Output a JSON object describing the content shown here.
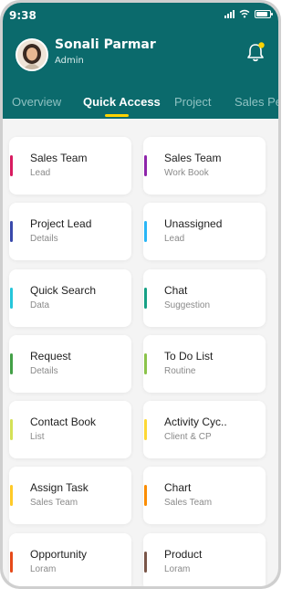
{
  "status_bar": {
    "time": "9:38"
  },
  "profile": {
    "name": "Sonali Parmar",
    "role": "Admin"
  },
  "tabs": [
    {
      "label": "Overview"
    },
    {
      "label": "Quick Access"
    },
    {
      "label": "Project"
    },
    {
      "label": "Sales Pe"
    }
  ],
  "cards": [
    {
      "title": "Sales Team",
      "subtitle": "Lead",
      "accent": "#d81b60"
    },
    {
      "title": "Sales Team",
      "subtitle": "Work Book",
      "accent": "#8e24aa"
    },
    {
      "title": "Project Lead",
      "subtitle": "Details",
      "accent": "#3949ab"
    },
    {
      "title": "Unassigned",
      "subtitle": "Lead",
      "accent": "#29b6f6"
    },
    {
      "title": "Quick Search",
      "subtitle": "Data",
      "accent": "#26c6da"
    },
    {
      "title": "Chat",
      "subtitle": "Suggestion",
      "accent": "#16a085"
    },
    {
      "title": "Request",
      "subtitle": "Details",
      "accent": "#43a047"
    },
    {
      "title": "To Do List",
      "subtitle": "Routine",
      "accent": "#8bc34a"
    },
    {
      "title": "Contact Book",
      "subtitle": "List",
      "accent": "#d4e157"
    },
    {
      "title": "Activity Cyc..",
      "subtitle": "Client & CP",
      "accent": "#fdd835"
    },
    {
      "title": "Assign Task",
      "subtitle": "Sales Team",
      "accent": "#ffca28"
    },
    {
      "title": "Chart",
      "subtitle": "Sales Team",
      "accent": "#fb8c00"
    },
    {
      "title": "Opportunity",
      "subtitle": "Loram",
      "accent": "#e64a19"
    },
    {
      "title": "Product",
      "subtitle": "Loram",
      "accent": "#795548"
    }
  ],
  "colors": {
    "header": "#0b6a6c",
    "tab_indicator": "#ffd300",
    "bell_dot": "#ffd300"
  }
}
